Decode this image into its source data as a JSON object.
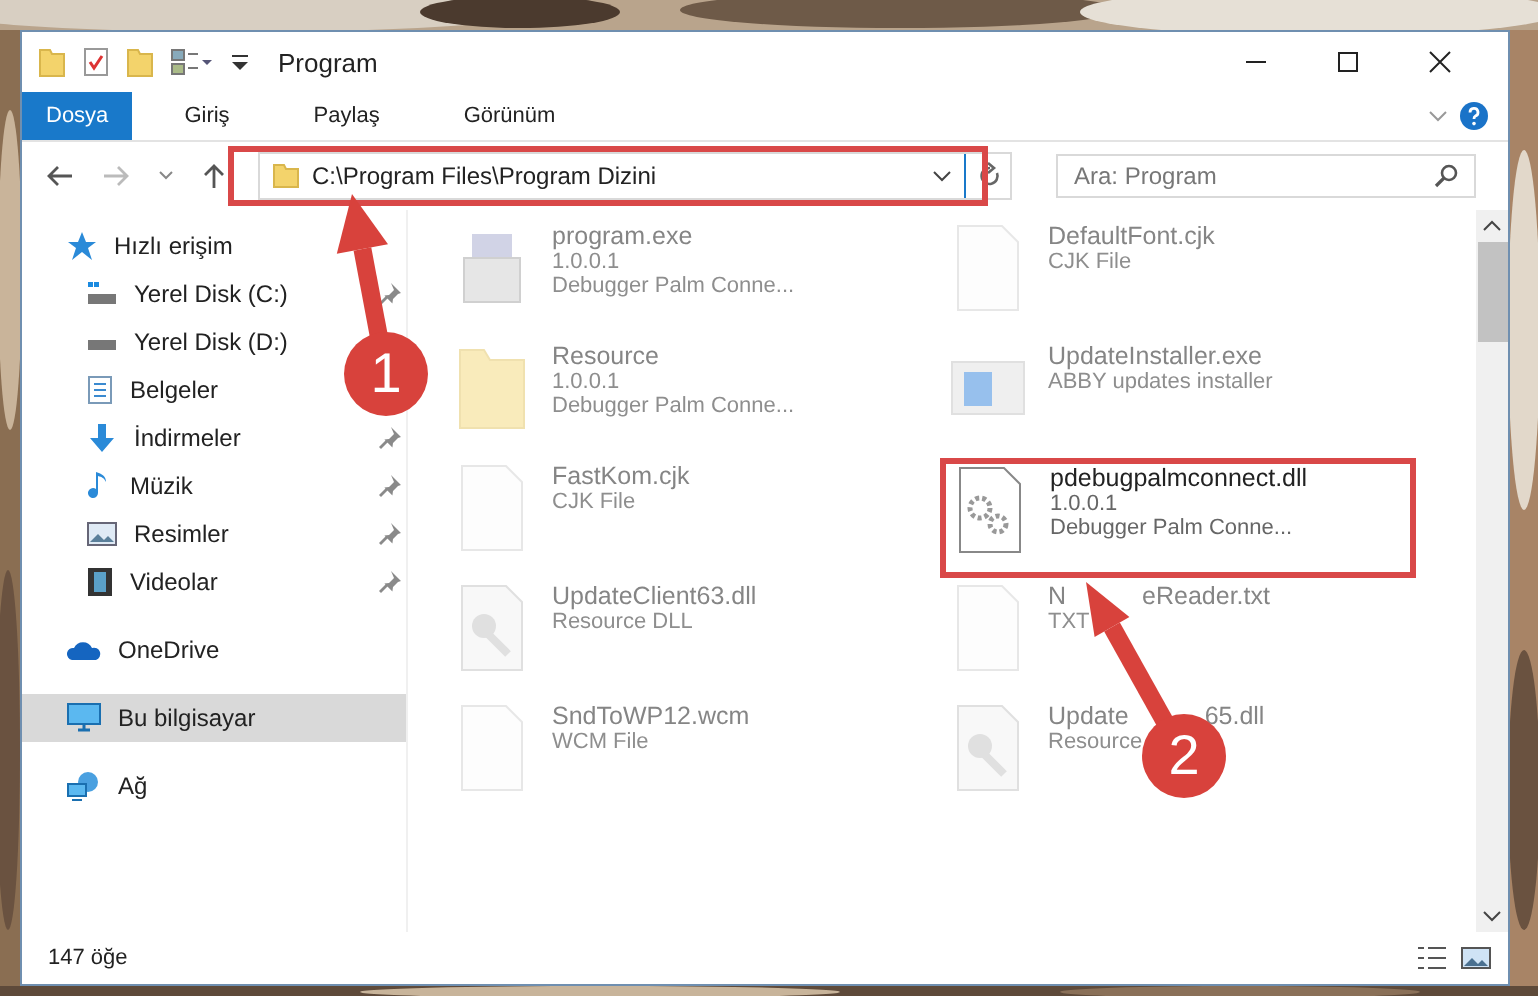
{
  "window": {
    "title": "Program"
  },
  "ribbon_tabs": [
    {
      "label": "Dosya",
      "selected": true
    },
    {
      "label": "Giriş",
      "selected": false
    },
    {
      "label": "Paylaş",
      "selected": false
    },
    {
      "label": "Görünüm",
      "selected": false
    }
  ],
  "address_bar": {
    "path": "C:\\Program Files\\Program Dizini"
  },
  "search": {
    "placeholder": "Ara: Program"
  },
  "sidebar": {
    "items": [
      {
        "label": "Hızlı erişim",
        "kind": "star",
        "selected": false,
        "children": [
          {
            "label": "Yerel Disk (C:)",
            "kind": "windrive",
            "pinned": true,
            "selected": false
          },
          {
            "label": "Yerel Disk (D:)",
            "kind": "drive",
            "pinned": false,
            "selected": false
          },
          {
            "label": "Belgeler",
            "kind": "docs",
            "pinned": false,
            "selected": false
          },
          {
            "label": "İndirmeler",
            "kind": "download",
            "pinned": true,
            "selected": false
          },
          {
            "label": "Müzik",
            "kind": "music",
            "pinned": true,
            "selected": false
          },
          {
            "label": "Resimler",
            "kind": "pictures",
            "pinned": true,
            "selected": false
          },
          {
            "label": "Videolar",
            "kind": "video",
            "pinned": true,
            "selected": false
          }
        ]
      },
      {
        "label": "OneDrive",
        "kind": "cloud",
        "selected": false
      },
      {
        "label": "Bu bilgisayar",
        "kind": "pc",
        "selected": true
      },
      {
        "label": "Ağ",
        "kind": "network",
        "selected": false
      }
    ]
  },
  "files": [
    {
      "name_parts": [
        "program.exe"
      ],
      "lines": [
        "1.0.0.1",
        "Debugger Palm Conne..."
      ],
      "kind": "exe",
      "focused": false
    },
    {
      "name_parts": [
        "DefaultFont.cjk"
      ],
      "lines": [
        "CJK File"
      ],
      "kind": "file",
      "focused": false
    },
    {
      "name_parts": [
        "Resource"
      ],
      "lines": [
        "1.0.0.1",
        "Debugger Palm Conne..."
      ],
      "kind": "folder",
      "focused": false
    },
    {
      "name_parts": [
        "UpdateInstaller.exe"
      ],
      "lines": [
        "ABBY updates installer"
      ],
      "kind": "installer",
      "focused": false
    },
    {
      "name_parts": [
        "FastKom.cjk"
      ],
      "lines": [
        "CJK File"
      ],
      "kind": "file",
      "focused": false
    },
    {
      "name_parts": [
        "pdebugpalmconnect.dll"
      ],
      "lines": [
        "1.0.0.1",
        "Debugger Palm Conne..."
      ],
      "kind": "gears",
      "focused": true
    },
    {
      "name_parts": [
        "UpdateClient63.dll"
      ],
      "lines": [
        "Resource DLL"
      ],
      "kind": "dll",
      "focused": false
    },
    {
      "name_parts": [
        "N",
        "eReader.txt"
      ],
      "lines": [
        "TXT"
      ],
      "kind": "file",
      "focused": false
    },
    {
      "name_parts": [
        "SndToWP12.wcm"
      ],
      "lines": [
        "WCM File"
      ],
      "kind": "file",
      "focused": false
    },
    {
      "name_parts": [
        "Update",
        "65.dll"
      ],
      "lines": [
        "Resource"
      ],
      "kind": "dll",
      "focused": false
    }
  ],
  "status_bar": {
    "count": "147 öğe"
  },
  "annotations": [
    {
      "label": "1"
    },
    {
      "label": "2"
    }
  ]
}
